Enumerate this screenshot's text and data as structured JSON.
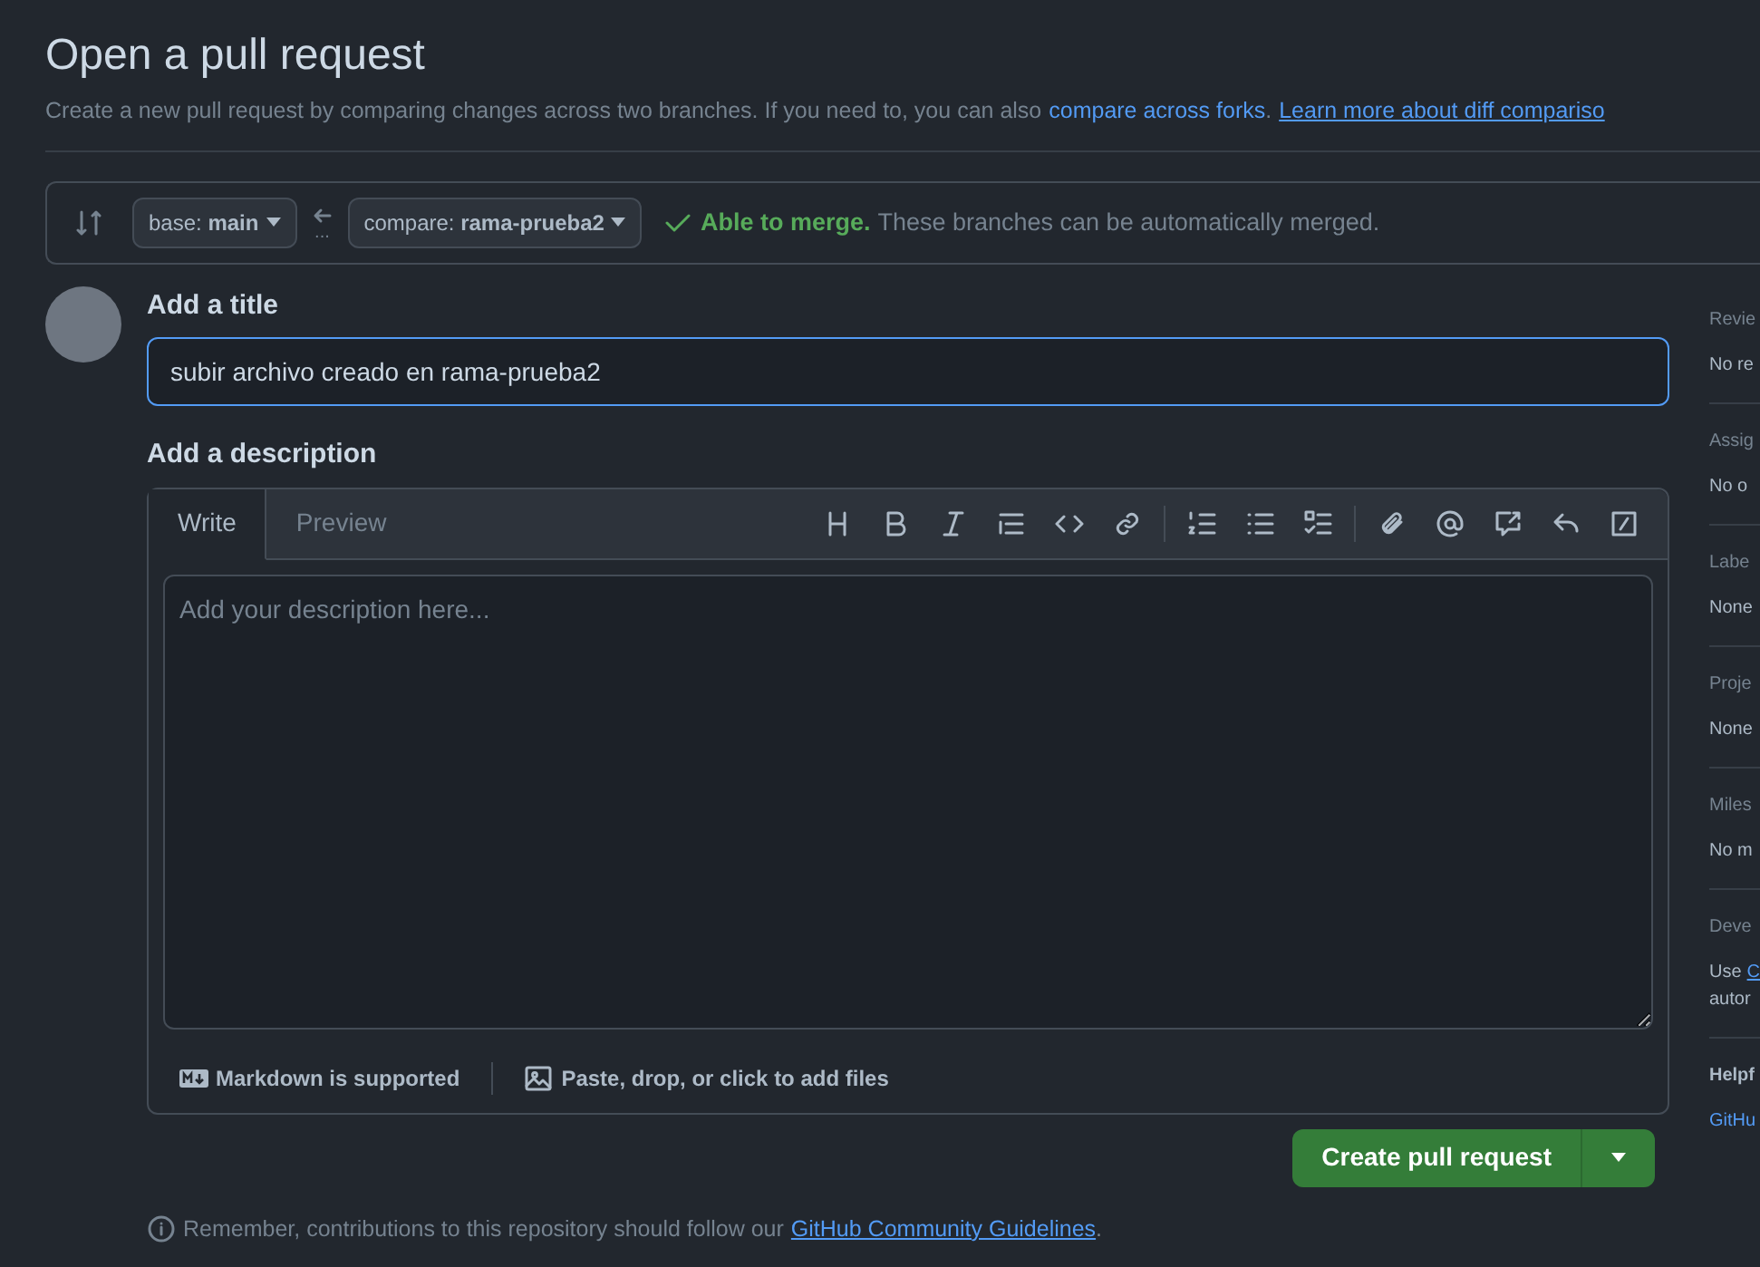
{
  "header": {
    "title": "Open a pull request",
    "description": "Create a new pull request by comparing changes across two branches. If you need to, you can also",
    "links": [
      "compare across forks",
      "Learn more about diff compariso"
    ],
    "separator": "."
  },
  "compare_bar": {
    "base": {
      "prefix": "base:",
      "branch": "main"
    },
    "ellipsis": "...",
    "compare": {
      "prefix": "compare:",
      "branch": "rama-prueba2"
    },
    "merge_status": {
      "mergeable": true,
      "label": "Able to merge.",
      "detail": "These branches can be automatically merged."
    }
  },
  "form": {
    "title_label": "Add a title",
    "title_value": "subir archivo creado en rama-prueba2",
    "description_label": "Add a description",
    "tabs": [
      {
        "label": "Write",
        "selected": true
      },
      {
        "label": "Preview",
        "selected": false
      }
    ],
    "placeholder": "Add your description here...",
    "footer": [
      "Markdown is supported",
      "Paste, drop, or click to add files"
    ],
    "submit": "Create pull request",
    "note": "Remember, contributions to this repository should follow our",
    "note_link": "GitHub Community Guidelines",
    "note_end": "."
  },
  "sidebar": [
    {
      "heading": "Revie",
      "value": "No re"
    },
    {
      "heading": "Assig",
      "value": "No o"
    },
    {
      "heading": "Labe",
      "value": "None"
    },
    {
      "heading": "Proje",
      "value": "None"
    },
    {
      "heading": "Miles",
      "value": "No m"
    },
    {
      "heading": "Deve",
      "value": "Use",
      "link": "C",
      "extra": "autor"
    },
    {
      "heading": "Helpf",
      "link_line": "GitHu"
    }
  ]
}
